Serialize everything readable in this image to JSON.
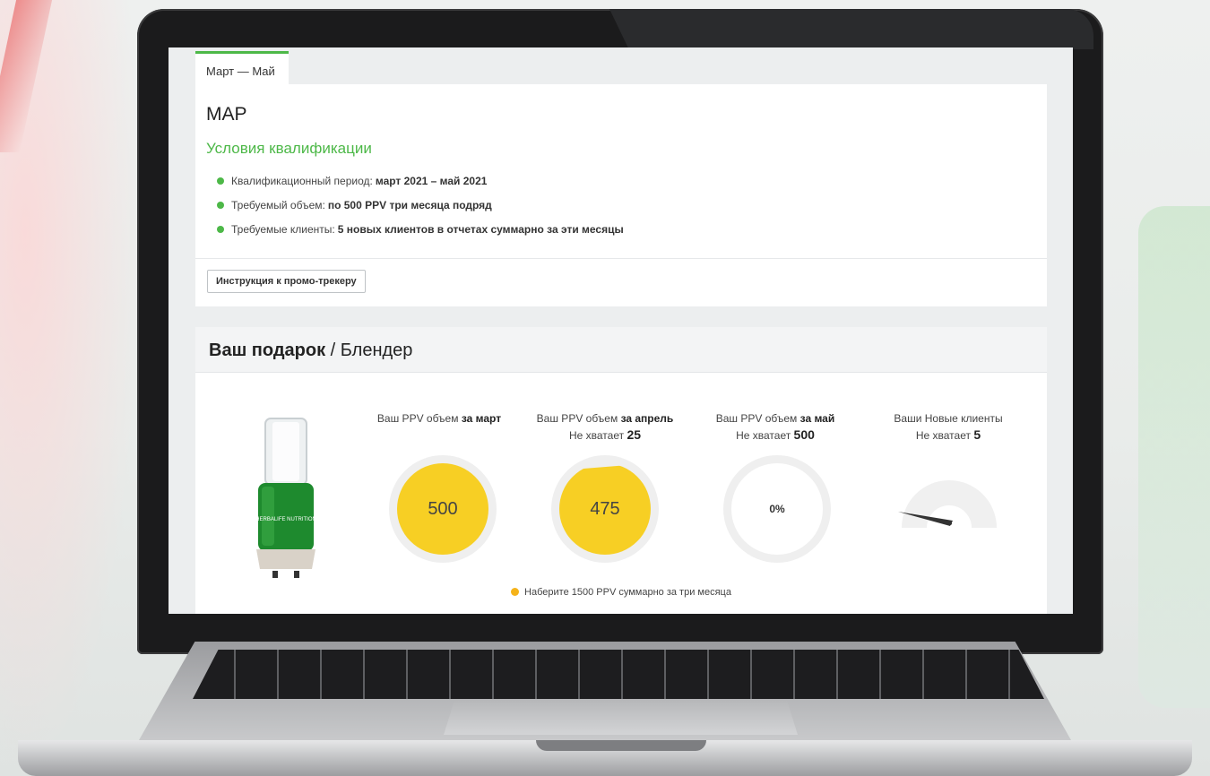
{
  "tab": {
    "label": "Март — Май"
  },
  "header": {
    "title": "MAP"
  },
  "conditions": {
    "title": "Условия квалификации",
    "items": [
      {
        "label": "Квалификационный период:",
        "value": "март 2021 – май 2021"
      },
      {
        "label": "Требуемый объем:",
        "value": "по 500 PPV три месяца подряд"
      },
      {
        "label": "Требуемые клиенты:",
        "value": "5 новых клиентов в отчетах суммарно за эти месяцы"
      }
    ]
  },
  "instruction_button": "Инструкция к промо-трекеру",
  "gift": {
    "title_bold": "Ваш подарок",
    "title_rest": " / Блендер",
    "product_brand": "HERBALIFE NUTRITION"
  },
  "trackers": [
    {
      "label": "Ваш PPV объем ",
      "label_bold": "за март",
      "shortfall_label": "",
      "shortfall_value": "",
      "value": "500",
      "fill": 1.0
    },
    {
      "label": "Ваш PPV объем ",
      "label_bold": "за апрель",
      "shortfall_label": "Не хватает ",
      "shortfall_value": "25",
      "value": "475",
      "fill": 0.95
    },
    {
      "label": "Ваш PPV объем ",
      "label_bold": "за май",
      "shortfall_label": "Не хватает ",
      "shortfall_value": "500",
      "value": "0%",
      "fill": 0
    },
    {
      "label": "Ваши Новые клиенты",
      "label_bold": "",
      "shortfall_label": "Не хватает ",
      "shortfall_value": "5",
      "value": "",
      "fill": 0
    }
  ],
  "footnote": "Наберите 1500 PPV суммарно за три месяца",
  "colors": {
    "accent": "#4db848",
    "progress": "#f7cf24",
    "footnote_dot": "#f5b31a"
  }
}
